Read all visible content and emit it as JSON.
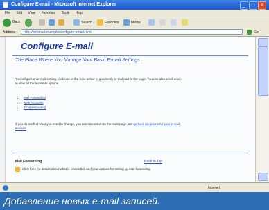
{
  "window": {
    "title": "Configure E-mail - Microsoft Internet Explorer"
  },
  "menu": [
    "File",
    "Edit",
    "View",
    "Favorites",
    "Tools",
    "Help"
  ],
  "toolbar": {
    "back": "Back",
    "search": "Search",
    "favorites": "Favorites",
    "media": "Media"
  },
  "address": {
    "label": "Address",
    "url": "http://webmail.example/configure-email.html",
    "go": "Go"
  },
  "page": {
    "title": "Configure E-mail",
    "subtitle": "The Place Where You Manage Your Basic E-mail Settings",
    "intro": "To configure an e-mail setting, click one of the links below to go directly to that part of the page. You can also scroll down to view all the available options.",
    "links": [
      "Mail Forwarding",
      "New Accounts",
      "Troubleshooting"
    ],
    "para2": "If you do not find what you need to change, you can also return to the main page and",
    "para2_link": "go back to options for your e-mail account",
    "section": {
      "heading": "Mail Forwarding",
      "link": "Back to Top"
    },
    "warning": "Click here for details about what is forwarded, and your options for setting up mail forwarding."
  },
  "status": {
    "zone": "Internet"
  },
  "caption": "Добавление новых e-mail записей."
}
